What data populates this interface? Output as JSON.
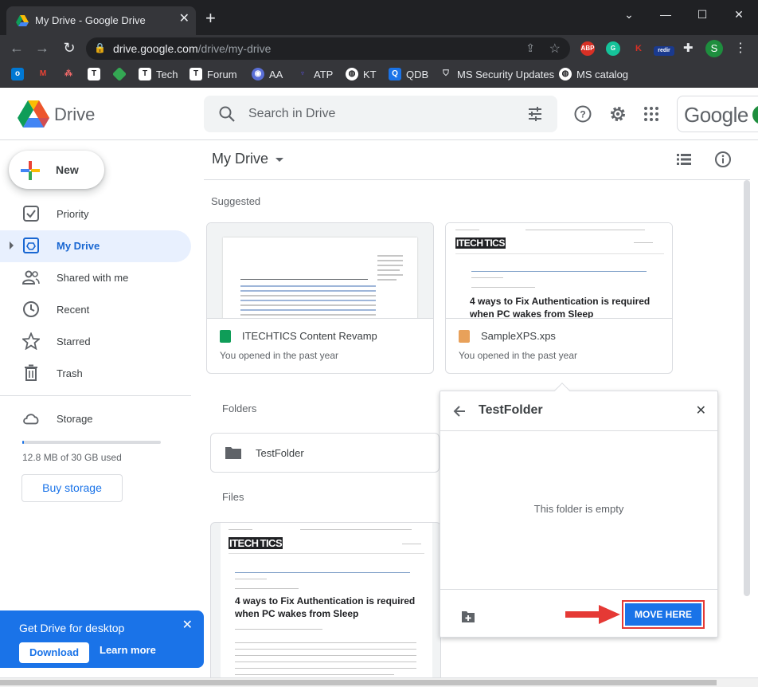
{
  "browser": {
    "tab_title": "My Drive - Google Drive",
    "url_host": "drive.google.com",
    "url_path": "/drive/my-drive",
    "extensions": [
      "ABP",
      "K",
      "redir"
    ],
    "profile_initial": "S",
    "bookmarks": [
      {
        "label": "",
        "icon": "outlook-icon"
      },
      {
        "label": "",
        "icon": "gmail-icon"
      },
      {
        "label": "",
        "icon": "asana-icon"
      },
      {
        "label": "",
        "icon": "itechtics-icon"
      },
      {
        "label": "",
        "icon": "green-diamond-icon"
      },
      {
        "label": "Tech",
        "icon": "itechtics-icon"
      },
      {
        "label": "Forum",
        "icon": "itechtics-icon"
      },
      {
        "label": "AA",
        "icon": "eye-icon"
      },
      {
        "label": "ATP",
        "icon": "atp-icon"
      },
      {
        "label": "KT",
        "icon": "globe-icon"
      },
      {
        "label": "QDB",
        "icon": "q-icon"
      },
      {
        "label": "MS Security Updates",
        "icon": "shield-icon"
      },
      {
        "label": "MS catalog",
        "icon": "globe-icon"
      }
    ]
  },
  "header": {
    "app_name": "Drive",
    "search_placeholder": "Search in Drive",
    "account_brand": "Google"
  },
  "sidebar": {
    "new_label": "New",
    "items": [
      {
        "label": "Priority",
        "icon": "priority-icon",
        "active": false
      },
      {
        "label": "My Drive",
        "icon": "my-drive-icon",
        "active": true
      },
      {
        "label": "Shared with me",
        "icon": "shared-icon",
        "active": false
      },
      {
        "label": "Recent",
        "icon": "clock-icon",
        "active": false
      },
      {
        "label": "Starred",
        "icon": "star-icon",
        "active": false
      },
      {
        "label": "Trash",
        "icon": "trash-icon",
        "active": false
      }
    ],
    "storage_label": "Storage",
    "storage_used": "12.8 MB of 30 GB used",
    "storage_fraction": 0.0004,
    "buy_storage": "Buy storage"
  },
  "promo": {
    "title": "Get Drive for desktop",
    "download": "Download",
    "learn_more": "Learn more"
  },
  "main": {
    "title": "My Drive",
    "suggested_label": "Suggested",
    "suggested": [
      {
        "name": "ITECHTICS Content Revamp",
        "meta": "You opened in the past year",
        "type": "sheets",
        "color": "#0f9d58"
      },
      {
        "name": "SampleXPS.xps",
        "meta": "You opened in the past year",
        "type": "xps",
        "color": "#e8a15a"
      }
    ],
    "folders_label": "Folders",
    "folders": [
      {
        "name": "TestFolder"
      }
    ],
    "files_label": "Files"
  },
  "preview": {
    "brand_a": "ITECH",
    "brand_b": "TICS",
    "headline": "4 ways to Fix Authentication is required when PC wakes from Sleep"
  },
  "move_dialog": {
    "title": "TestFolder",
    "empty_text": "This folder is empty",
    "action": "MOVE HERE"
  },
  "colors": {
    "accent": "#1a73e8",
    "highlight": "#e53935"
  }
}
